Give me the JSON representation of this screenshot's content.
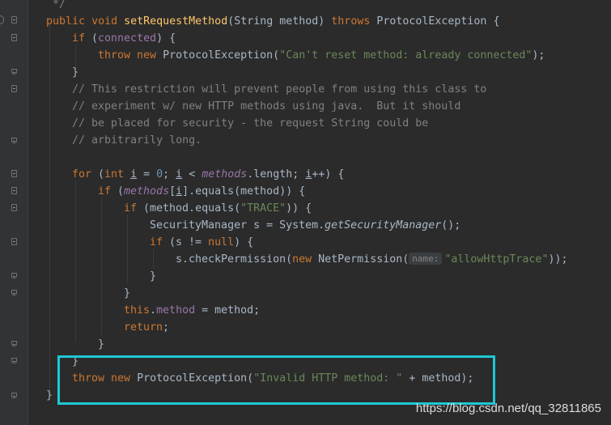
{
  "editor": {
    "language": "java",
    "lines": {
      "l0": "*/",
      "l1a": "public",
      "l1b": "void",
      "l1c": "setRequestMethod",
      "l1d": "(String method) ",
      "l1e": "throws",
      "l1f": " ProtocolException {",
      "l2a": "if",
      "l2b": " (",
      "l2c": "connected",
      "l2d": ") {",
      "l3a": "throw",
      "l3b": "new",
      "l3c": " ProtocolException(",
      "l3d": "\"Can't reset method: already connected\"",
      "l3e": ");",
      "l4": "}",
      "l5": "// This restriction will prevent people from using this class to",
      "l6": "// experiment w/ new HTTP methods using java.  But it should",
      "l7": "// be placed for security - the request String could be",
      "l8": "// arbitrarily long.",
      "l10a": "for",
      "l10b": " (",
      "l10c": "int",
      "l10d": " ",
      "l10e": "i",
      "l10f": " = ",
      "l10g": "0",
      "l10h": "; ",
      "l10i": "i",
      "l10j": " < ",
      "l10k": "methods",
      "l10l": ".length; ",
      "l10m": "i",
      "l10n": "++) {",
      "l11a": "if",
      "l11b": " (",
      "l11c": "methods",
      "l11d": "[",
      "l11e": "i",
      "l11f": "].equals(method)) {",
      "l12a": "if",
      "l12b": " (method.equals(",
      "l12c": "\"TRACE\"",
      "l12d": ")) {",
      "l13a": "SecurityManager s = System.",
      "l13b": "getSecurityManager",
      "l13c": "();",
      "l14a": "if",
      "l14b": " (s != ",
      "l14c": "null",
      "l14d": ") {",
      "l15a": "s.checkPermission(",
      "l15b": "new",
      "l15c": " NetPermission(",
      "l15hint": "name:",
      "l15d": "\"allowHttpTrace\"",
      "l15e": "));",
      "l16": "}",
      "l17": "}",
      "l18a": "this",
      "l18b": ".",
      "l18c": "method",
      "l18d": " = method;",
      "l19a": "return",
      "l19b": ";",
      "l20": "}",
      "l21": "}",
      "l22a": "throw",
      "l22b": "new",
      "l22c": " ProtocolException(",
      "l22d": "\"Invalid HTTP method: \"",
      "l22e": " + method);",
      "l23": "}"
    }
  },
  "watermark": "https://blog.csdn.net/qq_32811865",
  "colors": {
    "background": "#2b2b2b",
    "keyword": "#cc7832",
    "string": "#6a8759",
    "comment": "#808080",
    "field": "#9876aa",
    "method_decl": "#ffc66d",
    "number": "#6897bb",
    "highlight_box": "#1fc8d4"
  }
}
